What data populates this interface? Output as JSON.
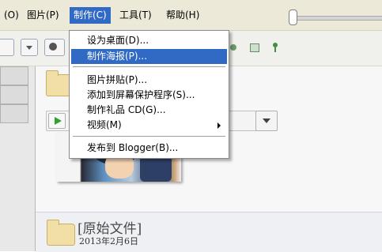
{
  "menubar": {
    "items": [
      {
        "label": "(O)"
      },
      {
        "label": "图片(P)"
      },
      {
        "label": "制作(C)"
      },
      {
        "label": "工具(T)"
      },
      {
        "label": "帮助(H)"
      }
    ]
  },
  "menu": {
    "items": [
      {
        "label": "设为桌面(D)..."
      },
      {
        "label": "制作海报(P)..."
      },
      {
        "label": "图片拼贴(P)..."
      },
      {
        "label": "添加到屏幕保护程序(S)..."
      },
      {
        "label": "制作礼品 CD(G)..."
      },
      {
        "label": "视频(M)"
      },
      {
        "label": "发布到 Blogger(B)..."
      }
    ],
    "highlighted_item": "制作海报(P)..."
  },
  "folder": {
    "title": "[原始文件]",
    "date": "2013年2月6日"
  },
  "colors": {
    "highlight": "#316ac5",
    "menubar_bg": "#ece9d8"
  }
}
